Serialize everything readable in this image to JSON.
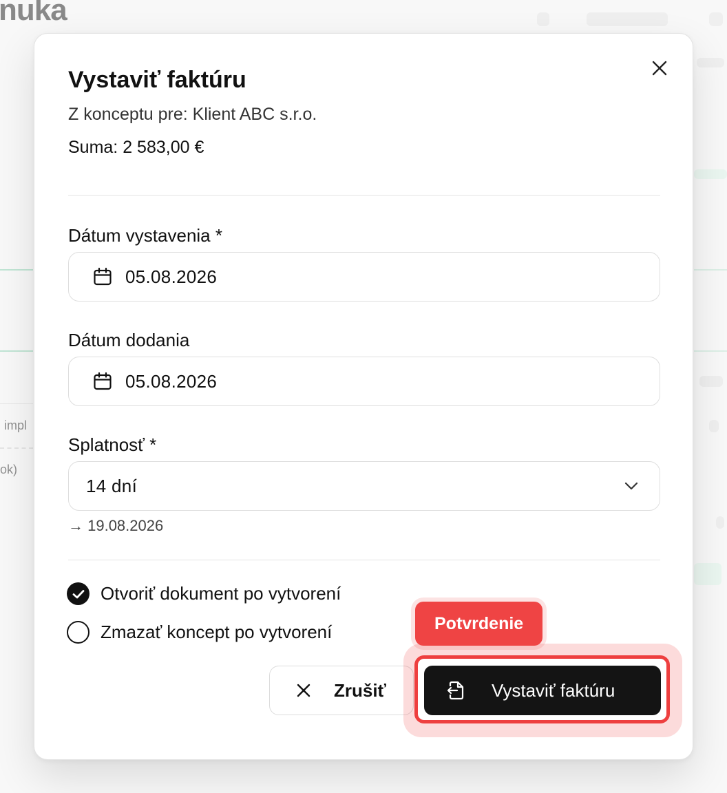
{
  "background": {
    "page_title_fragment": "nuka",
    "row_text_1": "impl",
    "row_text_2": "ok)"
  },
  "modal": {
    "title": "Vystaviť faktúru",
    "subtitle": "Z konceptu pre: Klient ABC s.r.o.",
    "sum": "Suma: 2 583,00 €",
    "fields": {
      "issue_date": {
        "label": "Dátum vystavenia *",
        "value": "05.08.2026"
      },
      "delivery_date": {
        "label": "Dátum dodania",
        "value": "05.08.2026"
      },
      "due": {
        "label": "Splatnosť *",
        "selected": "14 dní",
        "due_hint": "→ 19.08.2026"
      }
    },
    "options": [
      {
        "label": "Otvoriť dokument po vytvorení",
        "checked": true
      },
      {
        "label": "Zmazať koncept po vytvorení",
        "checked": false
      }
    ],
    "actions": {
      "cancel_label": "Zrušiť",
      "confirm_label": "Vystaviť faktúru"
    }
  },
  "annotation": {
    "badge_label": "Potvrdenie",
    "highlight_color": "#ef4444"
  },
  "icons": {
    "close": "close-icon",
    "calendar": "calendar-icon",
    "select": "chevron-down-icon",
    "check": "check-icon",
    "cancel": "x-icon",
    "confirm": "document-export-icon"
  }
}
